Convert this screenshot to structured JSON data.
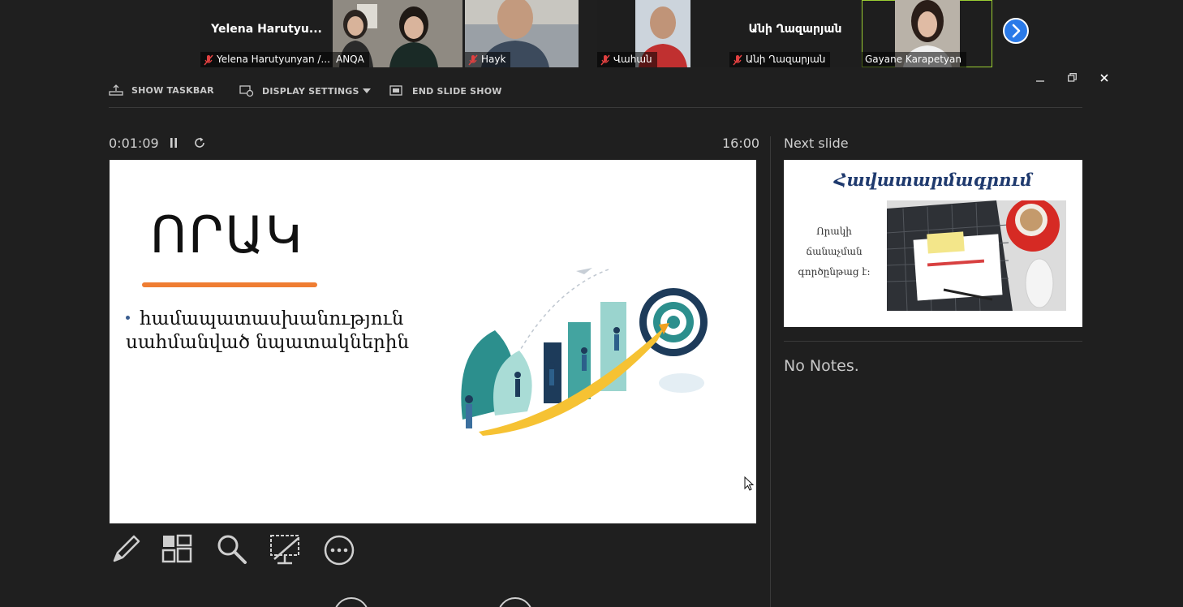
{
  "participants": [
    {
      "display_name": "Yelena  Harutyu...",
      "caption": "Yelena Harutyunyan /...",
      "muted": true
    },
    {
      "caption": "ANQA",
      "muted": false
    },
    {
      "caption": "Hayk",
      "muted": true
    },
    {
      "caption": "Վահան",
      "muted": true
    },
    {
      "display_name": "Անի Ղազարյան",
      "caption": "Անի Ղազարյան",
      "muted": true
    },
    {
      "caption": "Gayane Karapetyan",
      "muted": false,
      "active": true
    }
  ],
  "toolbar": {
    "show_taskbar": "SHOW TASKBAR",
    "display_settings": "DISPLAY SETTINGS",
    "end_slide_show": "END SLIDE SHOW"
  },
  "timer": {
    "elapsed": "0:01:09",
    "clock": "16:00"
  },
  "current_slide": {
    "title": "ՈՐԱԿ",
    "bullet": "համապատասխանություն սահմանված նպատակներին"
  },
  "next_slide": {
    "heading": "Next slide",
    "title": "Հավատարմագրում",
    "body": "Որակի ճանաչման գործընթաց է:"
  },
  "notes": "No Notes.",
  "colors": {
    "background": "#1f1f1f",
    "accent": "#ef7d32",
    "active_border": "#9acd32",
    "nav_button": "#2a7ae8"
  },
  "icons": [
    "mic-off-icon",
    "chevron-right-icon",
    "taskbar-icon",
    "display-settings-icon",
    "end-show-icon",
    "pause-icon",
    "restart-icon",
    "pen-icon",
    "slides-grid-icon",
    "zoom-icon",
    "screen-icon",
    "more-icon"
  ]
}
